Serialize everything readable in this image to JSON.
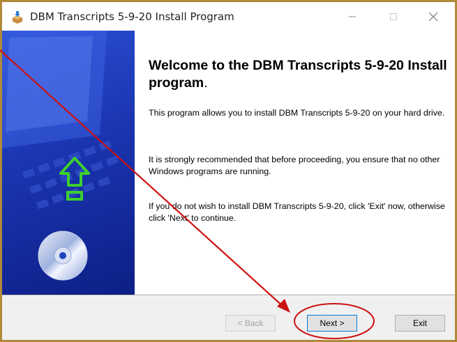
{
  "window": {
    "title": "DBM Transcripts 5-9-20 Install Program",
    "app_icon": "installer-box-icon",
    "controls": [
      "minimize-icon",
      "maximize-icon",
      "close-icon"
    ]
  },
  "content": {
    "heading": "Welcome to the DBM Transcripts 5-9-20 Install program",
    "heading_dot": ".",
    "paragraph1": "This program allows you to install DBM Transcripts 5-9-20 on your hard drive.",
    "paragraph2": "It is strongly recommended that before proceeding, you ensure that no other Windows programs are running.",
    "paragraph3": "If you do not wish to install DBM Transcripts 5-9-20, click 'Exit' now, otherwise click 'Next' to continue."
  },
  "buttons": {
    "back": "< Back",
    "next": "Next >",
    "exit": "Exit"
  },
  "colors": {
    "annotation": "#cc1111",
    "banner": "#1a35b0",
    "arrow": "#3ecf2e"
  }
}
